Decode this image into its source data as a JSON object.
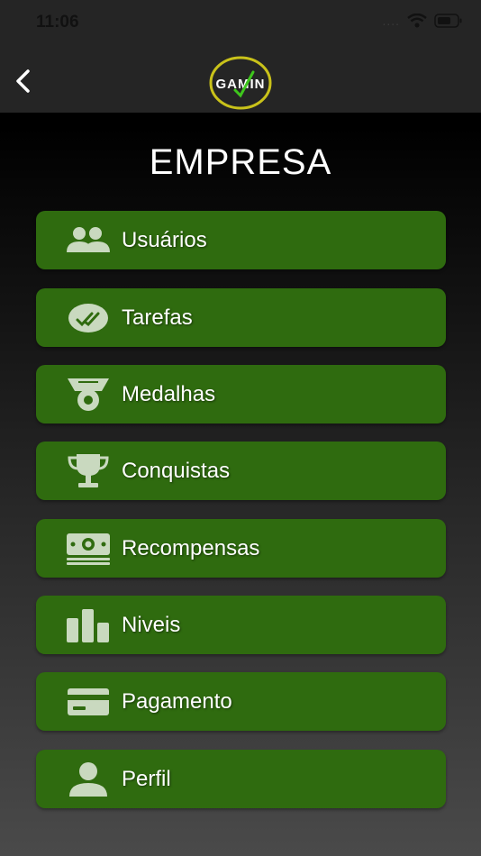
{
  "status_bar": {
    "time": "11:06",
    "dots": "....",
    "wifi_icon": "wifi-icon",
    "battery_icon": "battery-icon"
  },
  "header": {
    "back_icon": "chevron-left-icon",
    "logo_text": "GAMIN"
  },
  "page": {
    "title": "EMPRESA"
  },
  "colors": {
    "accent_green": "#2f6b0f",
    "icon_color": "#c9d9bf",
    "logo_yellow": "#c9c21a"
  },
  "menu": {
    "items": [
      {
        "label": "Usuários",
        "icon": "users-icon"
      },
      {
        "label": "Tarefas",
        "icon": "task-check-icon"
      },
      {
        "label": "Medalhas",
        "icon": "medal-icon"
      },
      {
        "label": "Conquistas",
        "icon": "trophy-icon"
      },
      {
        "label": "Recompensas",
        "icon": "money-icon"
      },
      {
        "label": "Niveis",
        "icon": "levels-icon"
      },
      {
        "label": "Pagamento",
        "icon": "credit-card-icon"
      },
      {
        "label": "Perfil",
        "icon": "user-icon"
      }
    ]
  }
}
